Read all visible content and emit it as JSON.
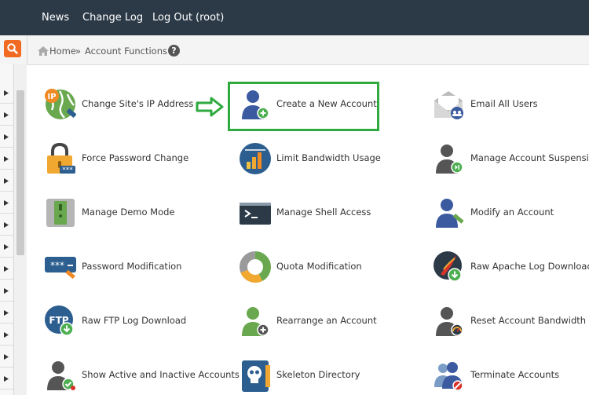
{
  "topnav": {
    "news": "News",
    "changelog": "Change Log",
    "logout": "Log Out (root)"
  },
  "breadcrumb": {
    "home": "Home",
    "separator": "»",
    "current": "Account Functions",
    "help": "?"
  },
  "colors": {
    "topbar": "#2c3a48",
    "search": "#f26a21",
    "highlight": "#2eaa3f",
    "crumbbar": "#f4f4f4"
  },
  "functions": [
    {
      "label": "Change Site's IP Address",
      "icon": "ip-address-icon"
    },
    {
      "label": "Create a New Account",
      "icon": "create-account-icon"
    },
    {
      "label": "Email All Users",
      "icon": "email-users-icon"
    },
    {
      "label": "Force Password Change",
      "icon": "password-lock-icon"
    },
    {
      "label": "Limit Bandwidth Usage",
      "icon": "bandwidth-chart-icon"
    },
    {
      "label": "Manage Account Suspension",
      "icon": "account-suspension-icon"
    },
    {
      "label": "Manage Demo Mode",
      "icon": "demo-mode-icon"
    },
    {
      "label": "Manage Shell Access",
      "icon": "shell-terminal-icon"
    },
    {
      "label": "Modify an Account",
      "icon": "modify-account-icon"
    },
    {
      "label": "Password Modification",
      "icon": "password-field-icon"
    },
    {
      "label": "Quota Modification",
      "icon": "quota-donut-icon"
    },
    {
      "label": "Raw Apache Log Download",
      "icon": "apache-log-icon"
    },
    {
      "label": "Raw FTP Log Download",
      "icon": "ftp-log-icon"
    },
    {
      "label": "Rearrange an Account",
      "icon": "rearrange-account-icon"
    },
    {
      "label": "Reset Account Bandwidth Limit",
      "icon": "reset-bandwidth-icon"
    },
    {
      "label": "Show Active and Inactive Accounts",
      "icon": "active-accounts-icon"
    },
    {
      "label": "Skeleton Directory",
      "icon": "skeleton-directory-icon"
    },
    {
      "label": "Terminate Accounts",
      "icon": "terminate-accounts-icon"
    }
  ]
}
